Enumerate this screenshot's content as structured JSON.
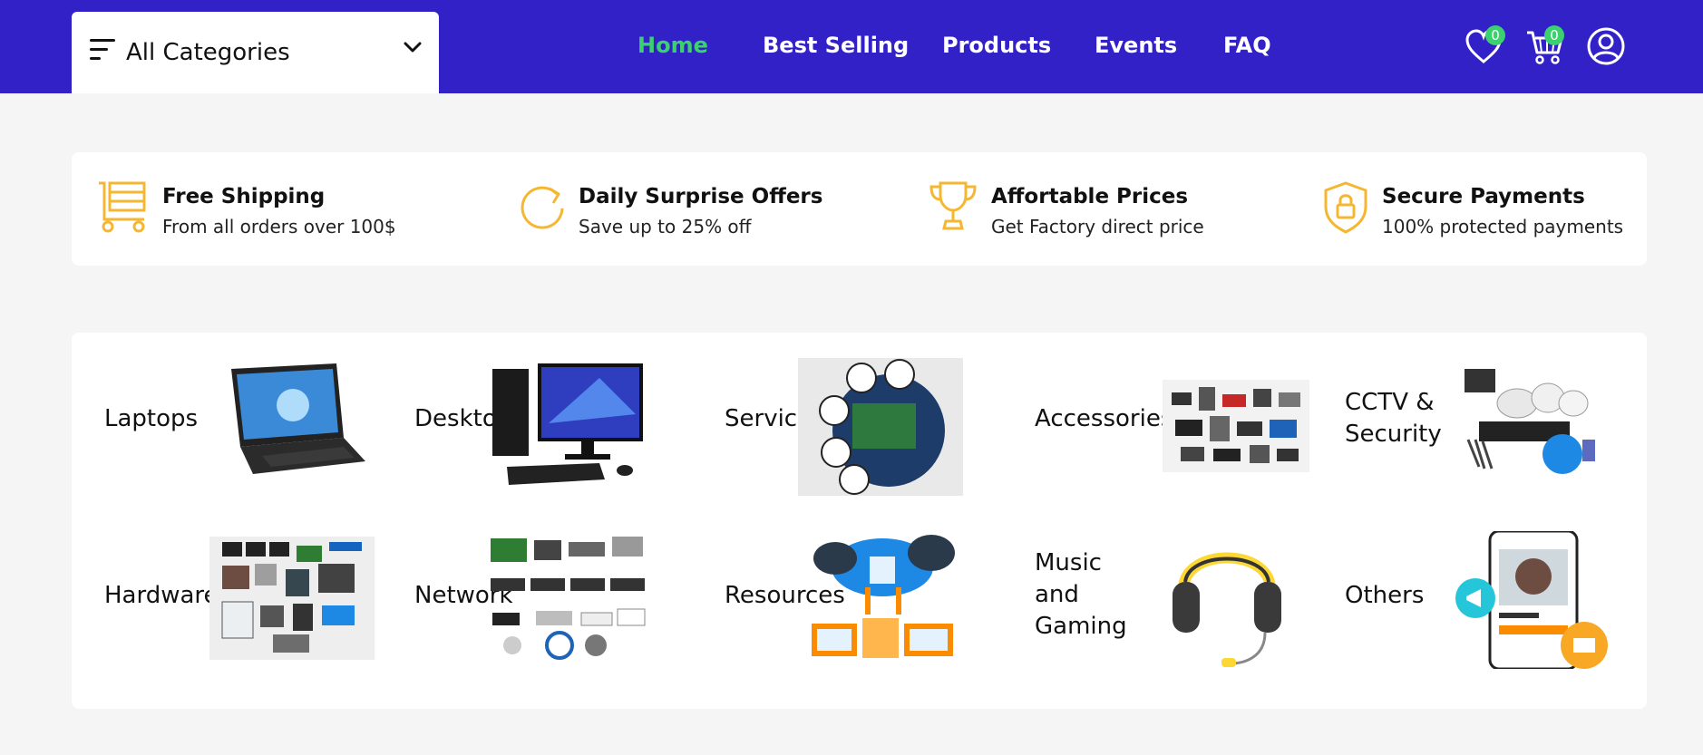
{
  "header": {
    "category_dropdown": {
      "label": "All Categories"
    },
    "nav": [
      {
        "label": "Home",
        "active": true
      },
      {
        "label": "Best Selling",
        "active": false
      },
      {
        "label": "Products",
        "active": false
      },
      {
        "label": "Events",
        "active": false
      },
      {
        "label": "FAQ",
        "active": false
      }
    ],
    "wishlist_count": "0",
    "cart_count": "0",
    "icons": [
      "menu-icon",
      "chevron-down-icon",
      "heart-icon",
      "cart-icon",
      "user-icon"
    ]
  },
  "features": [
    {
      "title": "Free Shipping",
      "subtitle": "From all orders over 100$",
      "icon": "cart-icon"
    },
    {
      "title": "Daily Surprise Offers",
      "subtitle": "Save up to 25% off",
      "icon": "refresh-icon"
    },
    {
      "title": "Affortable Prices",
      "subtitle": "Get Factory direct price",
      "icon": "trophy-icon"
    },
    {
      "title": "Secure Payments",
      "subtitle": "100% protected payments",
      "icon": "shield-lock-icon"
    }
  ],
  "categories": [
    {
      "name": "Laptops",
      "image": "laptop"
    },
    {
      "name": "Desktop",
      "image": "desktop"
    },
    {
      "name": "Service",
      "image": "service"
    },
    {
      "name": "Accessories",
      "image": "accessories"
    },
    {
      "name": "CCTV & Security",
      "image": "cctv"
    },
    {
      "name": "Hardware",
      "image": "hardware"
    },
    {
      "name": "Network",
      "image": "network"
    },
    {
      "name": "Resources",
      "image": "resources"
    },
    {
      "name": "Music and Gaming",
      "image": "headphones"
    },
    {
      "name": "Others",
      "image": "others"
    }
  ],
  "colors": {
    "header_bg": "#3321c8",
    "active_nav": "#3bd16f",
    "badge": "#3bd16f",
    "feature_icon": "#f5b731",
    "page_bg": "#f5f5f5"
  }
}
